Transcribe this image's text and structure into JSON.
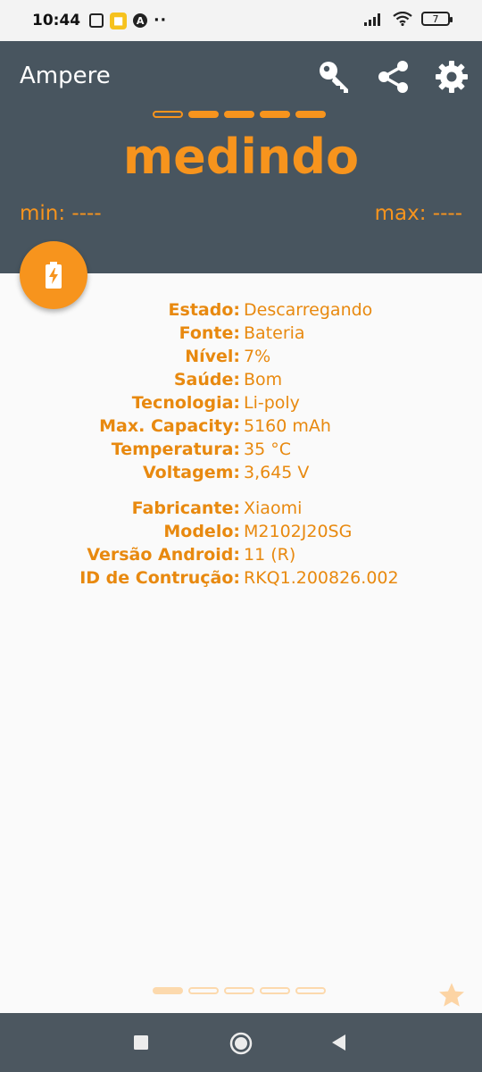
{
  "status_bar": {
    "time": "10:44",
    "battery_level": "7"
  },
  "app": {
    "title": "Ampere",
    "toolbar_icons": [
      "key-icon",
      "share-icon",
      "gear-icon"
    ],
    "accent_color": "#f7941d",
    "header_color": "#48555f"
  },
  "meter": {
    "status_text": "medindo",
    "min_label": "min: ----",
    "max_label": "max: ----",
    "pages_total": 5,
    "current_page": 1
  },
  "battery_info": [
    {
      "label": "Estado:",
      "value": "Descarregando"
    },
    {
      "label": "Fonte:",
      "value": "Bateria"
    },
    {
      "label": "Nível:",
      "value": "7%"
    },
    {
      "label": "Saúde:",
      "value": "Bom"
    },
    {
      "label": "Tecnologia:",
      "value": "Li-poly"
    },
    {
      "label": "Max. Capacity:",
      "value": "5160 mAh"
    },
    {
      "label": "Temperatura:",
      "value": "35 °C"
    },
    {
      "label": "Voltagem:",
      "value": "3,645 V"
    }
  ],
  "device_info": [
    {
      "label": "Fabricante:",
      "value": "Xiaomi"
    },
    {
      "label": "Modelo:",
      "value": "M2102J20SG"
    },
    {
      "label": "Versão Android:",
      "value": "11 (R)"
    },
    {
      "label": "ID de Contrução:",
      "value": "RKQ1.200826.002"
    }
  ]
}
